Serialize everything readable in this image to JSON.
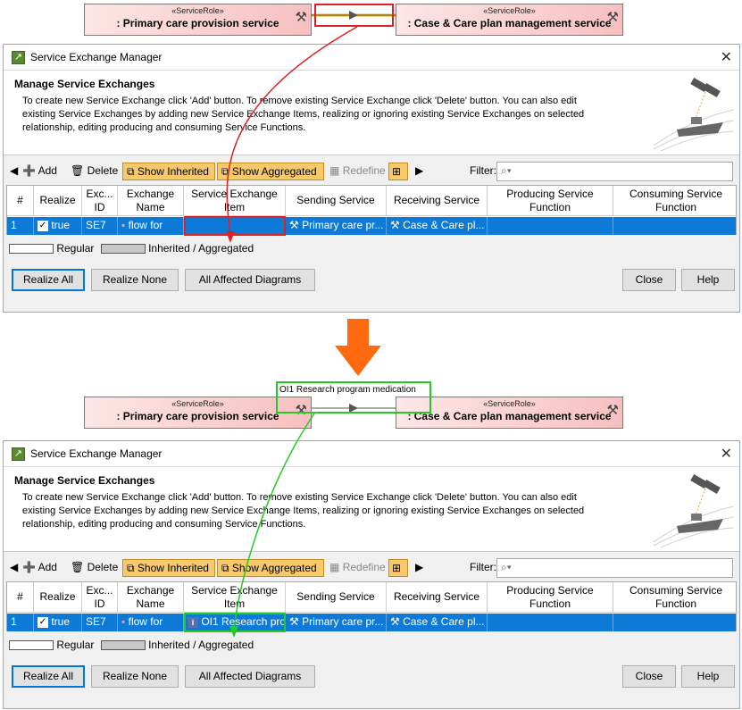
{
  "top_diagram": {
    "left_role": {
      "stereotype": "«ServiceRole»",
      "name": ": Primary care provision service"
    },
    "right_role": {
      "stereotype": "«ServiceRole»",
      "name": ": Case & Care plan management service"
    }
  },
  "bottom_diagram": {
    "left_role": {
      "stereotype": "«ServiceRole»",
      "name": ": Primary care provision service"
    },
    "right_role": {
      "stereotype": "«ServiceRole»",
      "name": ": Case & Care plan management service"
    },
    "item_label": "OI1 Research program medication"
  },
  "dialog1": {
    "title": "Service Exchange Manager",
    "header_title": "Manage Service Exchanges",
    "header_desc": "To create new Service Exchange click 'Add' button. To remove existing Service Exchange click 'Delete' button. You can also edit existing Service Exchanges by adding new Service Exchange Items, realizing or ignoring existing Service Exchanges on selected relationship, editing producing and consuming Service Functions.",
    "toolbar": {
      "add": "Add",
      "delete": "Delete",
      "show_inherited": "Show Inherited",
      "show_aggregated": "Show Aggregated",
      "redefine": "Redefine",
      "filter": "Filter:"
    },
    "columns": [
      "#",
      "Realize",
      "Exc... ID",
      "Exchange Name",
      "Service Exchange Item",
      "Sending Service",
      "Receiving Service",
      "Producing Service Function",
      "Consuming Service Function"
    ],
    "row": {
      "num": "1",
      "realize": "true",
      "id": "SE7",
      "name": "flow for",
      "item": "",
      "sending": "Primary care pr...",
      "receiving": "Case & Care pl...",
      "producing": "",
      "consuming": ""
    },
    "legend": {
      "regular": "Regular",
      "inherited": "Inherited / Aggregated"
    },
    "buttons": {
      "realize_all": "Realize All",
      "realize_none": "Realize None",
      "affected": "All Affected Diagrams",
      "close": "Close",
      "help": "Help"
    }
  },
  "dialog2": {
    "title": "Service Exchange Manager",
    "header_title": "Manage Service Exchanges",
    "header_desc": "To create new Service Exchange click 'Add' button. To remove existing Service Exchange click 'Delete' button. You can also edit existing Service Exchanges by adding new Service Exchange Items, realizing or ignoring existing Service Exchanges on selected relationship, editing producing and consuming Service Functions.",
    "toolbar": {
      "add": "Add",
      "delete": "Delete",
      "show_inherited": "Show Inherited",
      "show_aggregated": "Show Aggregated",
      "redefine": "Redefine",
      "filter": "Filter:"
    },
    "columns": [
      "#",
      "Realize",
      "Exc... ID",
      "Exchange Name",
      "Service Exchange Item",
      "Sending Service",
      "Receiving Service",
      "Producing Service Function",
      "Consuming Service Function"
    ],
    "row": {
      "num": "1",
      "realize": "true",
      "id": "SE7",
      "name": "flow for",
      "item": "OI1 Research pro",
      "sending": "Primary care pr...",
      "receiving": "Case & Care pl...",
      "producing": "",
      "consuming": ""
    },
    "legend": {
      "regular": "Regular",
      "inherited": "Inherited / Aggregated"
    },
    "buttons": {
      "realize_all": "Realize All",
      "realize_none": "Realize None",
      "affected": "All Affected Diagrams",
      "close": "Close",
      "help": "Help"
    }
  },
  "colors": {
    "selection": "#0e7ad7",
    "highlight_red": "#e02020",
    "highlight_green": "#22cc22",
    "arrow_orange": "#ff6a10",
    "toggle_on": "#f7c96d"
  }
}
